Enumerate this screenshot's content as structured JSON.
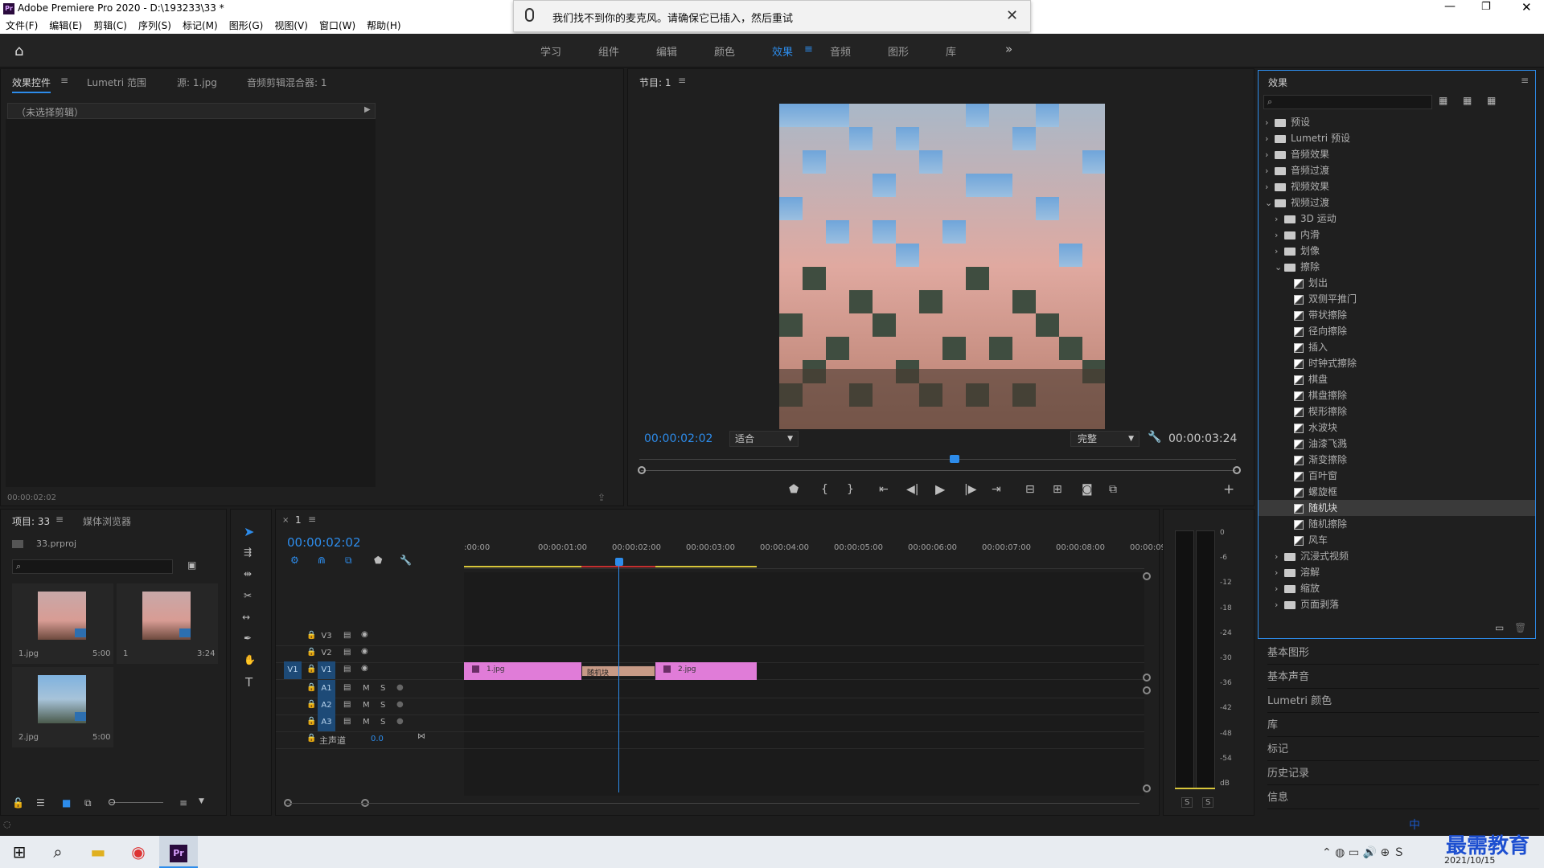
{
  "window": {
    "title": "Adobe Premiere Pro 2020 - D:\\193233\\33 *",
    "app_icon": "Pr"
  },
  "menu": [
    "文件(F)",
    "编辑(E)",
    "剪辑(C)",
    "序列(S)",
    "标记(M)",
    "图形(G)",
    "视图(V)",
    "窗口(W)",
    "帮助(H)"
  ],
  "notification": {
    "text": "我们找不到你的麦克风。请确保它已插入，然后重试",
    "icon": "microphone-icon"
  },
  "workspaces": [
    {
      "label": "学习",
      "active": false
    },
    {
      "label": "组件",
      "active": false
    },
    {
      "label": "编辑",
      "active": false
    },
    {
      "label": "颜色",
      "active": false
    },
    {
      "label": "效果",
      "active": true
    },
    {
      "label": "音频",
      "active": false
    },
    {
      "label": "图形",
      "active": false
    },
    {
      "label": "库",
      "active": false
    }
  ],
  "source_panel": {
    "tabs": [
      "效果控件",
      "Lumetri 范围",
      "源: 1.jpg",
      "音频剪辑混合器: 1"
    ],
    "no_clip": "（未选择剪辑）",
    "timecode": "00:00:02:02"
  },
  "program": {
    "title": "节目: 1",
    "timecode": "00:00:02:02",
    "fit": "适合",
    "quality": "完整",
    "duration": "00:00:03:24"
  },
  "project": {
    "tabs": [
      "项目: 33",
      "媒体浏览器"
    ],
    "file": "33.prproj",
    "items": [
      {
        "name": "1.jpg",
        "duration": "5:00"
      },
      {
        "name": "1",
        "duration": "3:24"
      },
      {
        "name": "2.jpg",
        "duration": "5:00"
      }
    ]
  },
  "timeline": {
    "tab": "1",
    "timecode": "00:00:02:02",
    "ruler": [
      ":00:00",
      "00:00:01:00",
      "00:00:02:00",
      "00:00:03:00",
      "00:00:04:00",
      "00:00:05:00",
      "00:00:06:00",
      "00:00:07:00",
      "00:00:08:00",
      "00:00:09:"
    ],
    "video_tracks": [
      "V3",
      "V2",
      "V1"
    ],
    "audio_tracks": [
      "A1",
      "A2",
      "A3"
    ],
    "master": "主声道",
    "master_value": "0.0",
    "source_patch_v": "V1",
    "source_patch_a": [
      "A1",
      "A2",
      "A3"
    ],
    "clips": {
      "clip1": "1.jpg",
      "transition": "随机块",
      "clip2": "2.jpg"
    },
    "mute": "M",
    "solo": "S"
  },
  "meter": {
    "scale": [
      "0",
      "-6",
      "-12",
      "-18",
      "-24",
      "-30",
      "-36",
      "-42",
      "-48",
      "-54",
      "dB"
    ],
    "solo": [
      "S",
      "S"
    ]
  },
  "effects_panel": {
    "title": "效果",
    "tree": [
      {
        "label": "预设",
        "level": 0,
        "type": "folder-preset",
        "open": false
      },
      {
        "label": "Lumetri 预设",
        "level": 0,
        "type": "folder-preset",
        "open": false
      },
      {
        "label": "音频效果",
        "level": 0,
        "type": "folder",
        "open": false
      },
      {
        "label": "音频过渡",
        "level": 0,
        "type": "folder",
        "open": false
      },
      {
        "label": "视频效果",
        "level": 0,
        "type": "folder",
        "open": false
      },
      {
        "label": "视频过渡",
        "level": 0,
        "type": "folder",
        "open": true
      },
      {
        "label": "3D 运动",
        "level": 1,
        "type": "folder",
        "open": false
      },
      {
        "label": "内滑",
        "level": 1,
        "type": "folder",
        "open": false
      },
      {
        "label": "划像",
        "level": 1,
        "type": "folder",
        "open": false
      },
      {
        "label": "擦除",
        "level": 1,
        "type": "folder",
        "open": true
      },
      {
        "label": "划出",
        "level": 2,
        "type": "fx"
      },
      {
        "label": "双侧平推门",
        "level": 2,
        "type": "fx"
      },
      {
        "label": "带状擦除",
        "level": 2,
        "type": "fx"
      },
      {
        "label": "径向擦除",
        "level": 2,
        "type": "fx"
      },
      {
        "label": "插入",
        "level": 2,
        "type": "fx"
      },
      {
        "label": "时钟式擦除",
        "level": 2,
        "type": "fx"
      },
      {
        "label": "棋盘",
        "level": 2,
        "type": "fx"
      },
      {
        "label": "棋盘擦除",
        "level": 2,
        "type": "fx"
      },
      {
        "label": "楔形擦除",
        "level": 2,
        "type": "fx"
      },
      {
        "label": "水波块",
        "level": 2,
        "type": "fx"
      },
      {
        "label": "油漆飞溅",
        "level": 2,
        "type": "fx"
      },
      {
        "label": "渐变擦除",
        "level": 2,
        "type": "fx"
      },
      {
        "label": "百叶窗",
        "level": 2,
        "type": "fx"
      },
      {
        "label": "螺旋框",
        "level": 2,
        "type": "fx"
      },
      {
        "label": "随机块",
        "level": 2,
        "type": "fx",
        "selected": true
      },
      {
        "label": "随机擦除",
        "level": 2,
        "type": "fx"
      },
      {
        "label": "风车",
        "level": 2,
        "type": "fx"
      },
      {
        "label": "沉浸式视频",
        "level": 1,
        "type": "folder",
        "open": false
      },
      {
        "label": "溶解",
        "level": 1,
        "type": "folder",
        "open": false
      },
      {
        "label": "缩放",
        "level": 1,
        "type": "folder",
        "open": false
      },
      {
        "label": "页面剥落",
        "level": 1,
        "type": "folder",
        "open": false
      }
    ]
  },
  "side_panels": [
    "基本图形",
    "基本声音",
    "Lumetri 颜色",
    "库",
    "标记",
    "历史记录",
    "信息"
  ],
  "taskbar": {
    "date": "2021/10/15",
    "watermark": "最需教育",
    "ime": "中"
  },
  "colors": {
    "accent": "#2d8ceb",
    "clip": "#e07cd8",
    "transition": "#c79a86",
    "selection": "#3a3a3a"
  }
}
